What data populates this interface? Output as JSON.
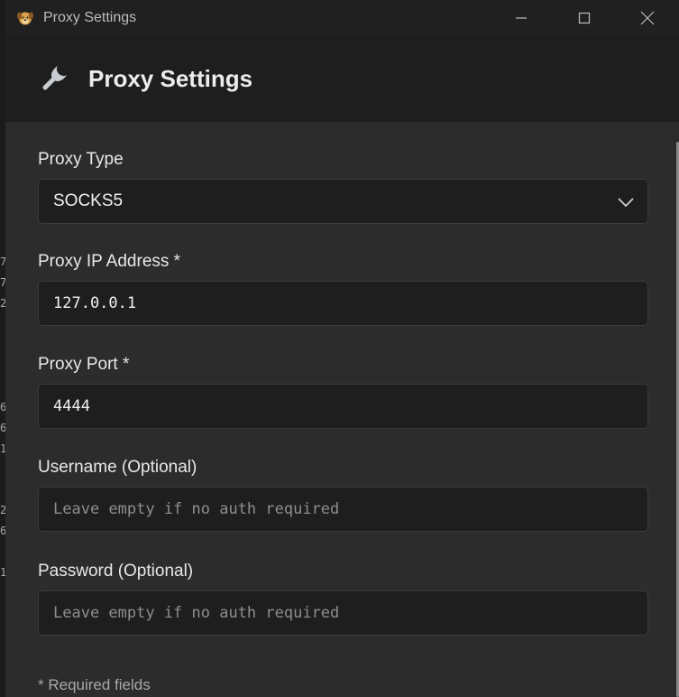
{
  "window": {
    "title": "Proxy Settings",
    "controls": {
      "minimize": "minimize",
      "maximize": "maximize",
      "close": "close"
    }
  },
  "header": {
    "icon": "wrench-icon",
    "title": "Proxy Settings"
  },
  "form": {
    "proxy_type": {
      "label": "Proxy Type",
      "value": "SOCKS5"
    },
    "proxy_ip": {
      "label": "Proxy IP Address *",
      "value": "127.0.0.1"
    },
    "proxy_port": {
      "label": "Proxy Port *",
      "value": "4444"
    },
    "username": {
      "label": "Username (Optional)",
      "placeholder": "Leave empty if no auth required"
    },
    "password": {
      "label": "Password (Optional)",
      "placeholder": "Leave empty if no auth required"
    }
  },
  "footer": {
    "note": "* Required fields"
  },
  "colors": {
    "window_bg": "#2b2b2b",
    "titlebar_bg": "#202020",
    "header_bg": "#1e1e1e",
    "input_bg": "#1e1e1e",
    "text": "#e8e8e8",
    "placeholder": "#8e8e8e"
  }
}
